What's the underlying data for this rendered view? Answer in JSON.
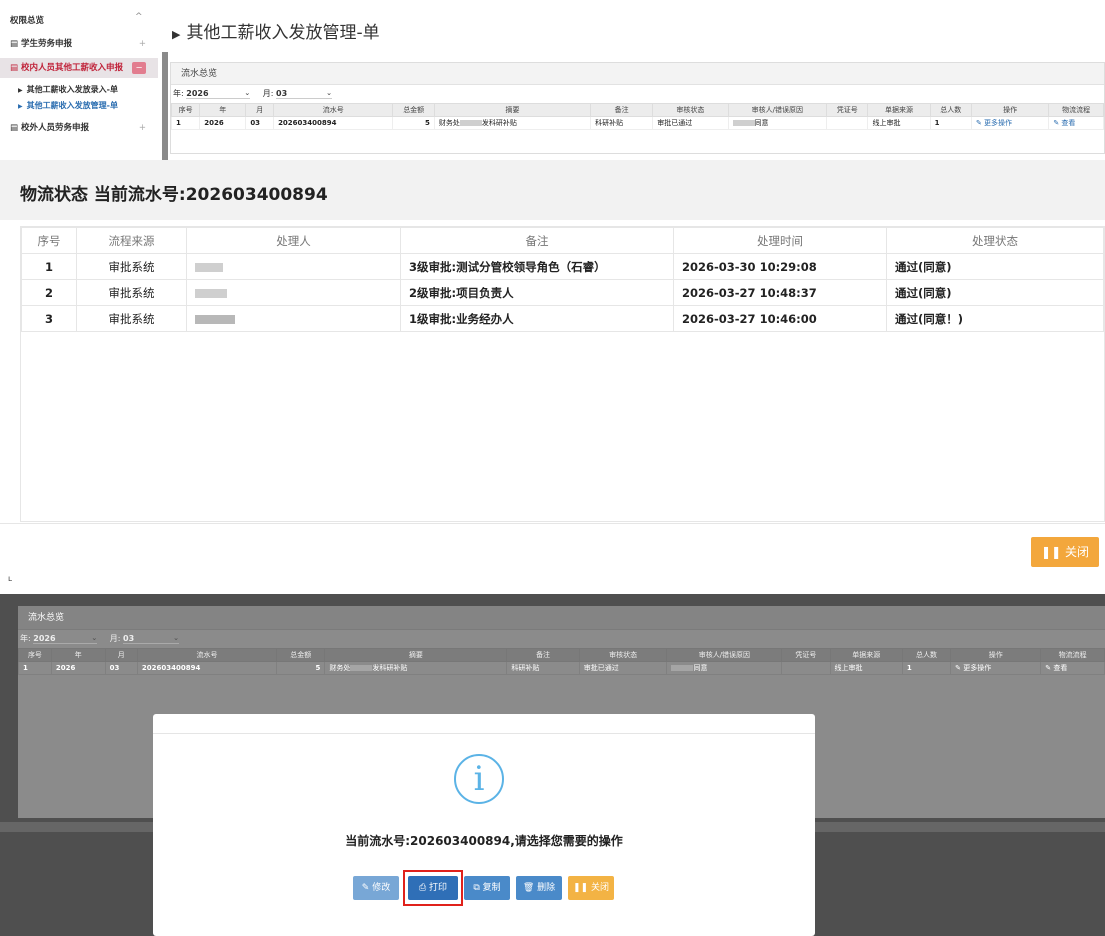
{
  "sidebar": {
    "title": "权限总览",
    "collapse_icon": "^",
    "items": [
      {
        "label": "学生劳务申报",
        "toggle": "+"
      },
      {
        "label": "校内人员其他工薪收入申报",
        "toggle": "−"
      },
      {
        "label": "校外人员劳务申报",
        "toggle": "+"
      }
    ],
    "sub_items": [
      {
        "label": "其他工薪收入发放录入-单"
      },
      {
        "label": "其他工薪收入发放管理-单"
      }
    ]
  },
  "page_title": "其他工薪收入发放管理-单",
  "overview": {
    "header": "流水总览",
    "year_label": "年:",
    "year_value": "2026",
    "month_label": "月:",
    "month_value": "03",
    "columns": [
      "序号",
      "年",
      "月",
      "流水号",
      "总金额",
      "摘要",
      "备注",
      "审核状态",
      "审核人/错误原因",
      "凭证号",
      "单据来源",
      "总人数",
      "操作",
      "物流流程"
    ],
    "row": {
      "idx": "1",
      "year": "2026",
      "month": "03",
      "serial": "202603400894",
      "amount": "5",
      "summary_a": "财务处",
      "summary_b": "发科研补贴",
      "remark": "科研补贴",
      "status": "审批已通过",
      "reviewer": "同意",
      "voucher": "",
      "source": "线上审批",
      "count": "1",
      "action": "✎ 更多操作",
      "flow": "✎ 查看"
    }
  },
  "logistics": {
    "title": "物流状态 当前流水号:202603400894",
    "columns": [
      "序号",
      "流程来源",
      "处理人",
      "备注",
      "处理时间",
      "处理状态"
    ],
    "rows": [
      {
        "idx": "1",
        "source": "审批系统",
        "note": "3级审批:测试分管校领导角色（石睿）",
        "time": "2026-03-30 10:29:08",
        "state": "通过(同意)"
      },
      {
        "idx": "2",
        "source": "审批系统",
        "note": "2级审批:项目负责人",
        "time": "2026-03-27 10:48:37",
        "state": "通过(同意)"
      },
      {
        "idx": "3",
        "source": "审批系统",
        "note": "1级审批:业务经办人",
        "time": "2026-03-27 10:46:00",
        "state": "通过(同意！)"
      }
    ],
    "close_label": "❚❚ 关闭"
  },
  "modal": {
    "icon": "i",
    "message": "当前流水号:202603400894,请选择您需要的操作",
    "buttons": {
      "edit": "✎ 修改",
      "print": "⎙ 打印",
      "copy": "⧉ 复制",
      "delete": "🗑 删除",
      "close": "❚❚ 关闭"
    }
  },
  "colors": {
    "accent_blue": "#2a6db0",
    "active_red": "#c0233a",
    "close_orange": "#f3a73c",
    "highlight_red": "#e0211b"
  }
}
